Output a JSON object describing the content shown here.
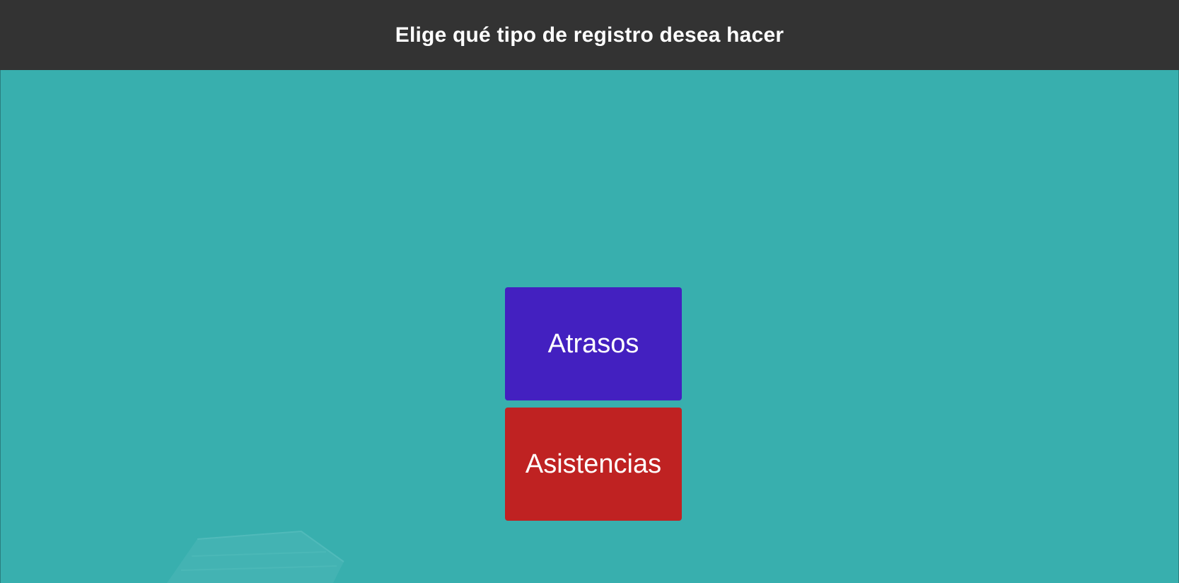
{
  "header": {
    "title": "Elige qué tipo de registro desea hacer"
  },
  "colors": {
    "header_background": "#333333",
    "page_background": "#38afae",
    "atrasos_button": "#4320c0",
    "asistencias_button": "#bf2222",
    "button_text": "#ffffff"
  },
  "options": {
    "atrasos_label": "Atrasos",
    "asistencias_label": "Asistencias"
  },
  "background": {
    "image": "building-roof-picture"
  }
}
